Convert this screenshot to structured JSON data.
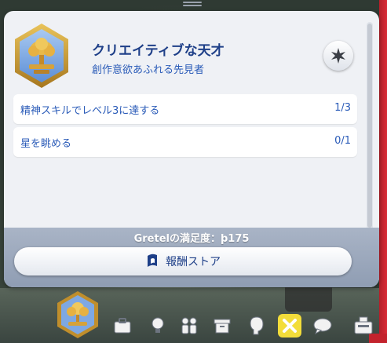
{
  "aspiration": {
    "title": "クリエイティブな天才",
    "subtitle": "創作意欲あふれる先見者",
    "badge_icon": "tree-cloud-icon"
  },
  "tasks": [
    {
      "label": "精神スキルでレベル3に達する",
      "progress": "1/3"
    },
    {
      "label": "星を眺める",
      "progress": "0/1"
    }
  ],
  "satisfaction": {
    "text": "Gretelの満足度：ϸ175"
  },
  "store_button": {
    "label": "報酬ストア"
  },
  "toolbar": {
    "items": [
      "aspiration-icon",
      "career-icon",
      "skills-icon",
      "relationships-icon",
      "inventory-icon",
      "simology-icon",
      "rabbit-hole-icon",
      "chat-icon"
    ],
    "active": "rabbit-hole-icon"
  },
  "colors": {
    "accent": "#1e3f88",
    "link": "#2a5bb8",
    "footer": "#9aa6b9",
    "active_tab": "#f3dd3a"
  }
}
